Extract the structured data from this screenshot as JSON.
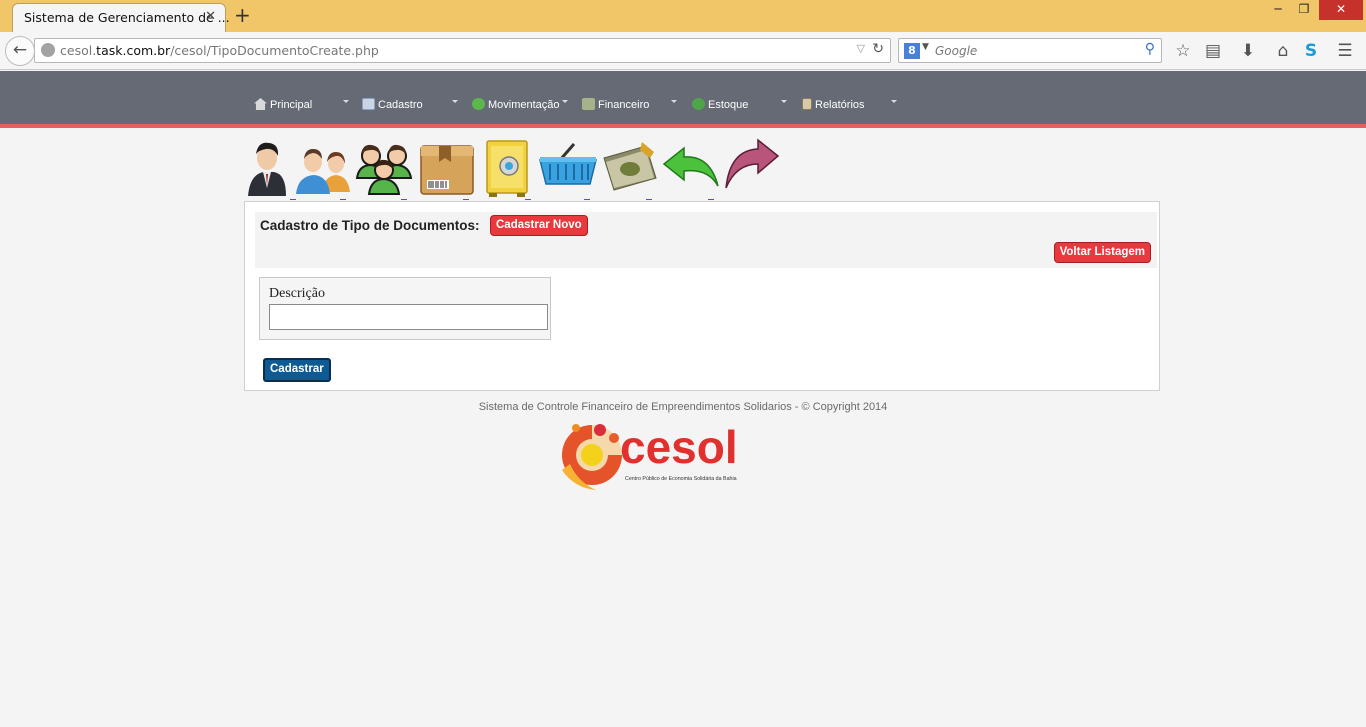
{
  "browser": {
    "tab_title": "Sistema de Gerenciamento de ...",
    "tab_close": "✕",
    "new_tab": "+",
    "url_prefix": "cesol.",
    "url_domain": "task.com.br",
    "url_path": "/cesol/TipoDocumentoCreate.php",
    "search_placeholder": "Google",
    "search_engine_letter": "8"
  },
  "menu": {
    "items": [
      {
        "label": "Principal",
        "icon": "home-icon"
      },
      {
        "label": "Cadastro",
        "icon": "card-icon"
      },
      {
        "label": "Movimentação",
        "icon": "cycle-icon"
      },
      {
        "label": "Financeiro",
        "icon": "money-icon"
      },
      {
        "label": "Estoque",
        "icon": "stock-icon"
      },
      {
        "label": "Relatórios",
        "icon": "report-icon"
      }
    ]
  },
  "shortcuts": [
    "user-businessman-icon",
    "users-couple-icon",
    "users-group-icon",
    "package-box-icon",
    "safe-vault-icon",
    "shopping-basket-icon",
    "money-bills-icon",
    "back-arrow-icon",
    "forward-arrow-icon"
  ],
  "page": {
    "title": "Cadastro de Tipo de Documentos:",
    "new_button": "Cadastrar Novo",
    "back_button": "Voltar Listagem",
    "field_label": "Descrição",
    "field_value": "",
    "submit_button": "Cadastrar"
  },
  "footer": {
    "copyright": "Sistema de Controle Financeiro de Empreendimentos Solidarios - © Copyright 2014",
    "logo_word": "cesol",
    "logo_subtitle": "Centro Público de Economia Solidária da Bahia"
  },
  "colors": {
    "menu_bg": "#656a74",
    "accent_red": "#e8393e",
    "submit_blue": "#0e5a95"
  }
}
